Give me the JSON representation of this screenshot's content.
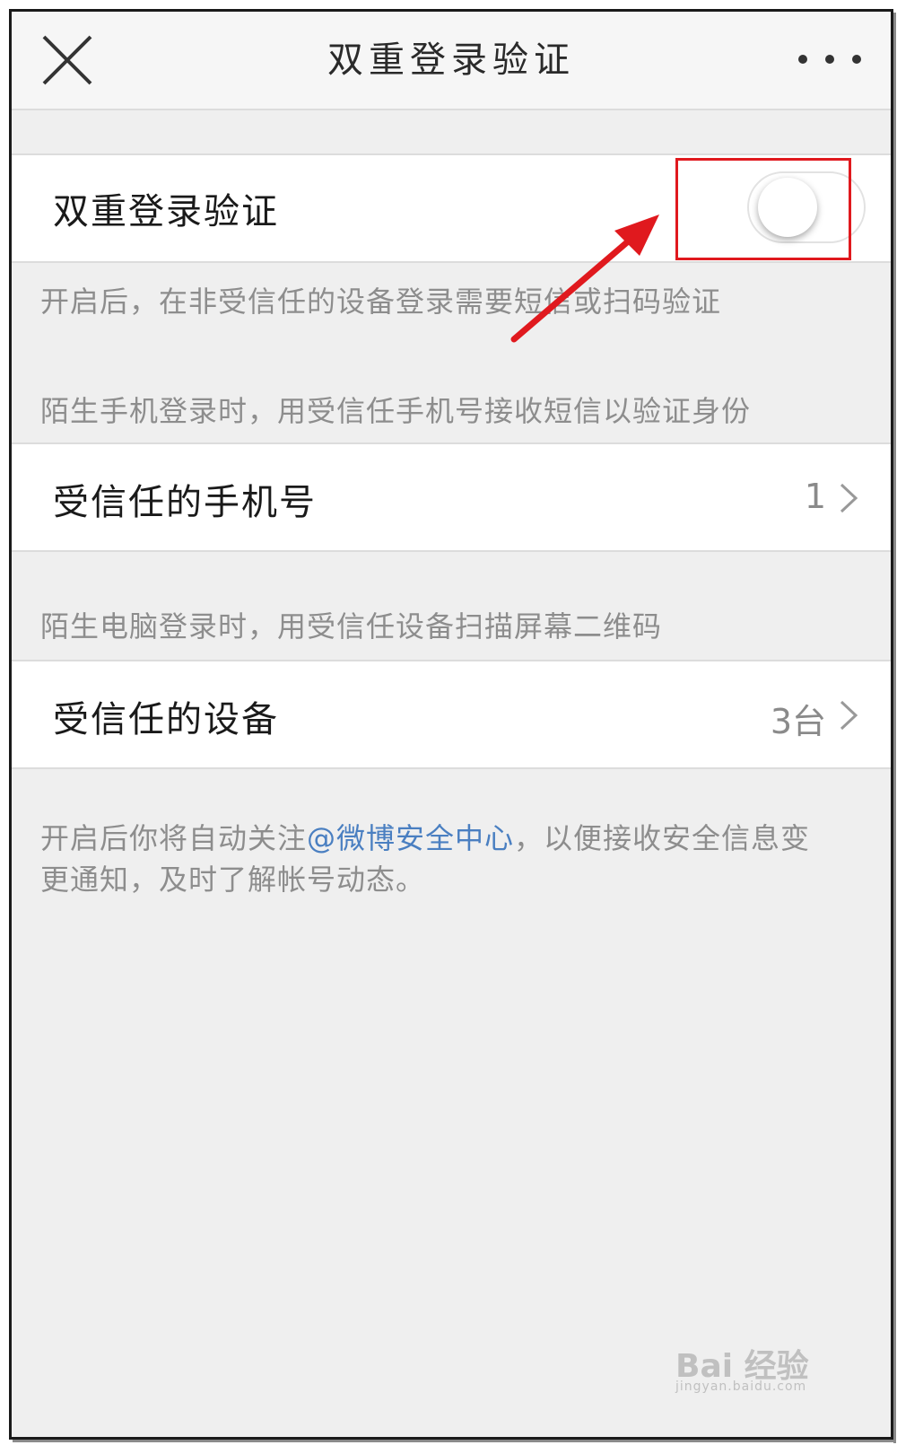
{
  "navbar": {
    "title": "双重登录验证",
    "close_icon": "close-icon",
    "more_icon": "more-dots-icon"
  },
  "two_factor": {
    "label": "双重登录验证",
    "toggle_state": "off",
    "note": "开启后，在非受信任的设备登录需要短信或扫码验证"
  },
  "phone_section": {
    "note": "陌生手机登录时，用受信任手机号接收短信以验证身份",
    "label": "受信任的手机号",
    "value": "1"
  },
  "device_section": {
    "note": "陌生电脑登录时，用受信任设备扫描屏幕二维码",
    "label": "受信任的设备",
    "value": "3台"
  },
  "footer": {
    "text_before": "开启后你将自动关注",
    "link": "@微博安全中心",
    "text_after": "，以便接收安全信息变更通知，及时了解帐号动态。"
  },
  "watermark": {
    "text": "Bai 经验",
    "sub": "jingyan.baidu.com"
  },
  "colors": {
    "accent_link": "#4a7fc1",
    "annotation_red": "#e0191e",
    "background": "#efefef"
  }
}
